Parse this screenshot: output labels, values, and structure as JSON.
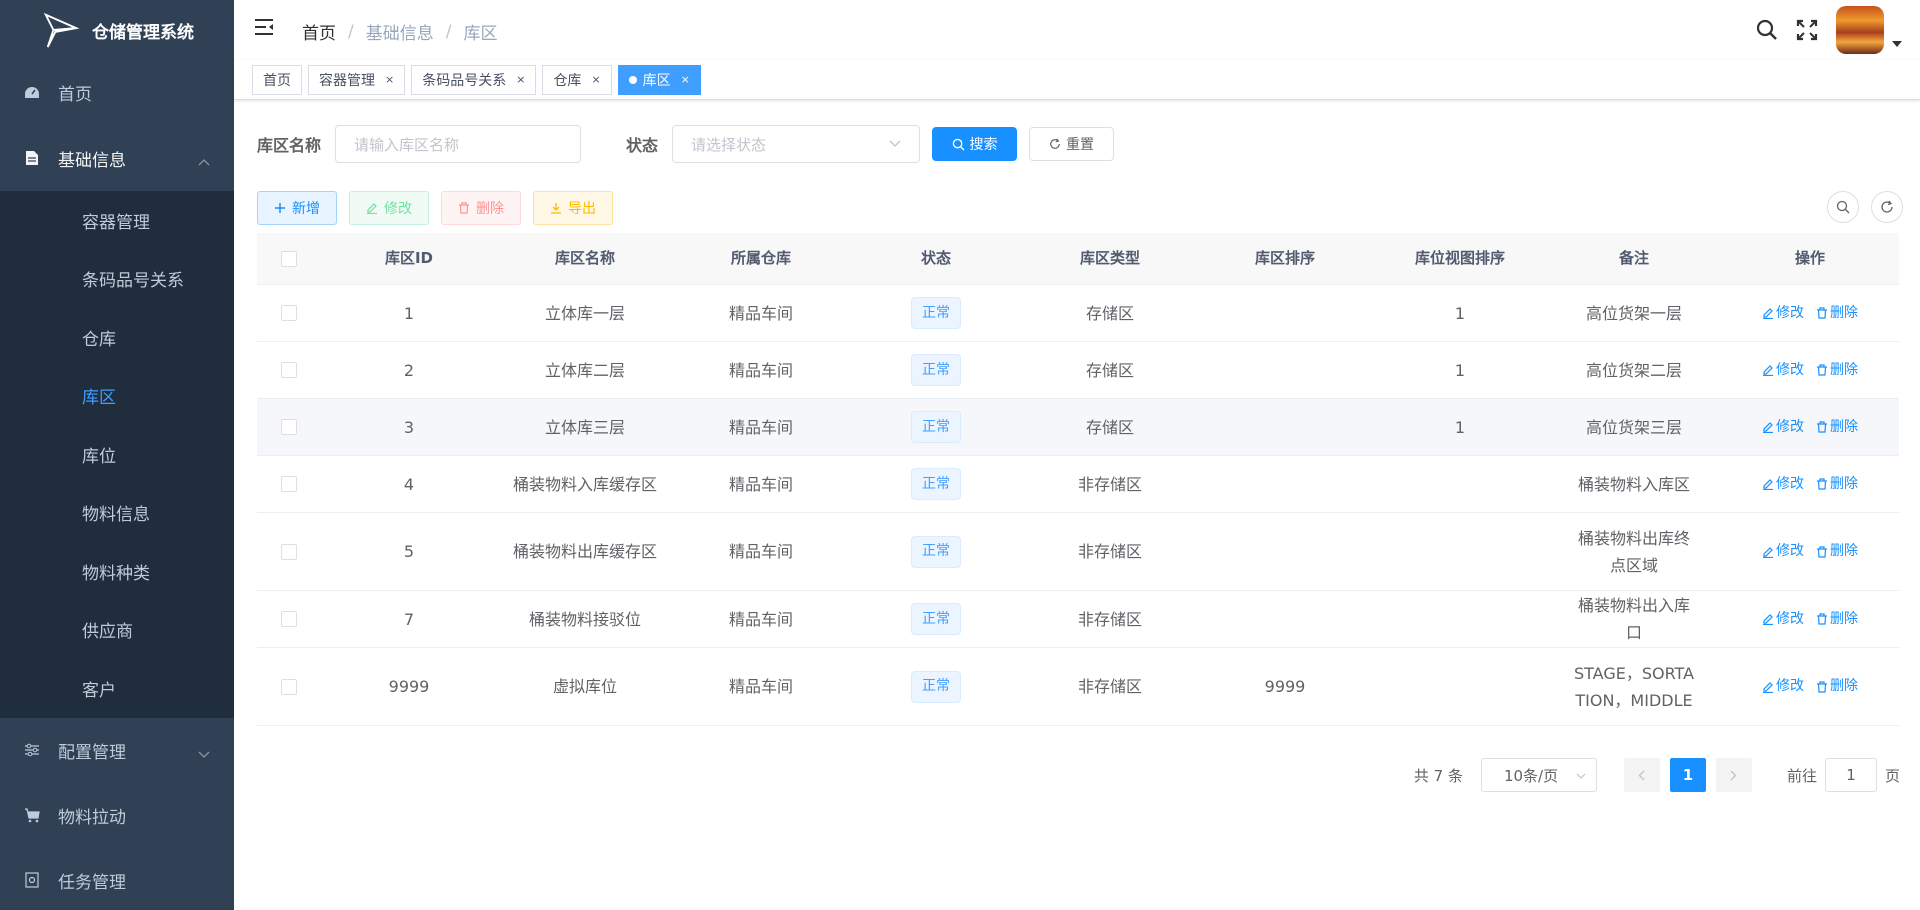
{
  "app": {
    "title": "仓储管理系统"
  },
  "sidebar": {
    "items": [
      {
        "label": "首页",
        "icon": "dashboard-icon"
      },
      {
        "label": "基础信息",
        "icon": "document-icon",
        "opened": true,
        "children": [
          "容器管理",
          "条码品号关系",
          "仓库",
          "库区",
          "库位",
          "物料信息",
          "物料种类",
          "供应商",
          "客户"
        ],
        "active_child": "库区"
      },
      {
        "label": "配置管理",
        "icon": "sliders-icon"
      },
      {
        "label": "物料拉动",
        "icon": "cart-icon"
      },
      {
        "label": "任务管理",
        "icon": "task-icon"
      }
    ]
  },
  "breadcrumb": [
    "首页",
    "基础信息",
    "库区"
  ],
  "tags": [
    {
      "label": "首页",
      "closable": false
    },
    {
      "label": "容器管理",
      "closable": true
    },
    {
      "label": "条码品号关系",
      "closable": true
    },
    {
      "label": "仓库",
      "closable": true
    },
    {
      "label": "库区",
      "closable": true,
      "active": true
    }
  ],
  "search": {
    "name_label": "库区名称",
    "name_placeholder": "请输入库区名称",
    "status_label": "状态",
    "status_placeholder": "请选择状态",
    "search_button": "搜索",
    "reset_button": "重置"
  },
  "toolbar": {
    "add": "新增",
    "edit": "修改",
    "delete": "删除",
    "export": "导出"
  },
  "table": {
    "columns": [
      "库区ID",
      "库区名称",
      "所属仓库",
      "状态",
      "库区类型",
      "库区排序",
      "库位视图排序",
      "备注",
      "操作"
    ],
    "rows": [
      {
        "id": "1",
        "name": "立体库一层",
        "warehouse": "精品车间",
        "status": "正常",
        "type": "存储区",
        "sort": "",
        "view_sort": "1",
        "remark": "高位货架一层"
      },
      {
        "id": "2",
        "name": "立体库二层",
        "warehouse": "精品车间",
        "status": "正常",
        "type": "存储区",
        "sort": "",
        "view_sort": "1",
        "remark": "高位货架二层"
      },
      {
        "id": "3",
        "name": "立体库三层",
        "warehouse": "精品车间",
        "status": "正常",
        "type": "存储区",
        "sort": "",
        "view_sort": "1",
        "remark": "高位货架三层"
      },
      {
        "id": "4",
        "name": "桶装物料入库缓存区",
        "warehouse": "精品车间",
        "status": "正常",
        "type": "非存储区",
        "sort": "",
        "view_sort": "",
        "remark": "桶装物料入库区"
      },
      {
        "id": "5",
        "name": "桶装物料出库缓存区",
        "warehouse": "精品车间",
        "status": "正常",
        "type": "非存储区",
        "sort": "",
        "view_sort": "",
        "remark": "桶装物料出库终点区域"
      },
      {
        "id": "7",
        "name": "桶装物料接驳位",
        "warehouse": "精品车间",
        "status": "正常",
        "type": "非存储区",
        "sort": "",
        "view_sort": "",
        "remark": "桶装物料出入库口"
      },
      {
        "id": "9999",
        "name": "虚拟库位",
        "warehouse": "精品车间",
        "status": "正常",
        "type": "非存储区",
        "sort": "9999",
        "view_sort": "",
        "remark": "STAGE，SORTATION，MIDDLE"
      }
    ],
    "op_edit": "修改",
    "op_delete": "删除"
  },
  "pagination": {
    "total_text": "共 7 条",
    "page_size": "10条/页",
    "current_page": "1",
    "goto_prefix": "前往",
    "goto_value": "1",
    "goto_suffix": "页"
  },
  "colors": {
    "primary": "#1890ff",
    "sidebar_bg": "#304156",
    "submenu_bg": "#1f2d3d",
    "active_menu": "#409eff"
  }
}
